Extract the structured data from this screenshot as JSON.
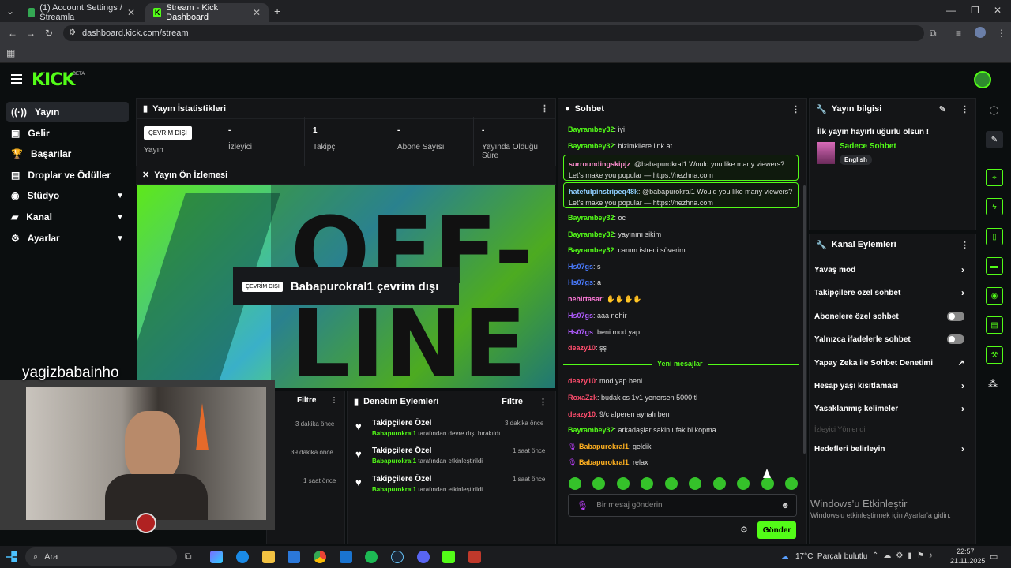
{
  "browser": {
    "tabs": [
      {
        "title": "(1) Account Settings / Streamla"
      },
      {
        "title": "Stream - Kick Dashboard"
      }
    ],
    "url": "dashboard.kick.com/stream"
  },
  "app": {
    "logo": "KICK",
    "beta": "BETA"
  },
  "sidebar": {
    "items": [
      {
        "label": "Yayın",
        "icon": "broadcast-icon"
      },
      {
        "label": "Gelir",
        "icon": "revenue-icon"
      },
      {
        "label": "Başarılar",
        "icon": "trophy-icon"
      },
      {
        "label": "Droplar ve Ödüller",
        "icon": "gift-icon"
      },
      {
        "label": "Stüdyo",
        "icon": "studio-icon"
      },
      {
        "label": "Kanal",
        "icon": "channel-icon"
      },
      {
        "label": "Ayarlar",
        "icon": "gear-icon"
      }
    ]
  },
  "stats": {
    "title": "Yayın İstatistikleri",
    "status_badge": "ÇEVRİM DIŞI",
    "items": [
      {
        "value": "",
        "label": "Yayın"
      },
      {
        "value": "-",
        "label": "İzleyici"
      },
      {
        "value": "1",
        "label": "Takipçi"
      },
      {
        "value": "-",
        "label": "Abone Sayısı"
      },
      {
        "value": "-",
        "label": "Yayında Olduğu Süre"
      }
    ]
  },
  "preview": {
    "title": "Yayın Ön İzlemesi",
    "bg_text_1": "OFF-",
    "bg_text_2": "LINE",
    "badge": "ÇEVRİM DIŞI",
    "message": "Babapurokral1 çevrim dışı"
  },
  "webcam": {
    "name": "yagizbabainho"
  },
  "left_feed": {
    "filter": "Filtre",
    "times": [
      "3 dakika önce",
      "39 dakika önce",
      "1 saat önce"
    ]
  },
  "moderation": {
    "title": "Denetim Eylemleri",
    "filter": "Filtre",
    "items": [
      {
        "title": "Takipçilere Özel",
        "user": "Babapurokral1",
        "action": "tarafından devre dışı bırakıldı",
        "time": "3 dakika önce"
      },
      {
        "title": "Takipçilere Özel",
        "user": "Babapurokral1",
        "action": "tarafından etkinleştirildi",
        "time": "1 saat önce"
      },
      {
        "title": "Takipçilere Özel",
        "user": "Babapurokral1",
        "action": "tarafından etkinleştirildi",
        "time": "1 saat önce"
      }
    ]
  },
  "chat": {
    "title": "Sohbet",
    "messages": [
      {
        "user": "Bayrambey32",
        "text": ": iyi",
        "color": "#53fc18"
      },
      {
        "user": "Bayrambey32",
        "text": ": bizimkilere link at",
        "color": "#53fc18"
      },
      {
        "user": "Bayrambey32",
        "text": ": oc",
        "color": "#53fc18"
      },
      {
        "user": "Bayrambey32",
        "text": ": yayınını sikim",
        "color": "#53fc18"
      },
      {
        "user": "Bayrambey32",
        "text": ": canım istredi söverim",
        "color": "#53fc18"
      },
      {
        "user": "Hs07gs",
        "text": ": s",
        "color": "#4a7bff"
      },
      {
        "user": "Hs07gs",
        "text": ": a",
        "color": "#4a7bff"
      },
      {
        "user": "nehirtasar",
        "text": ": ✋✋✋✋",
        "color": "#ff7ad9"
      },
      {
        "user": "Hs07gs",
        "text": ": aaa nehir",
        "color": "#b05cff"
      },
      {
        "user": "Hs07gs",
        "text": ": beni mod yap",
        "color": "#b05cff"
      },
      {
        "user": "deazy10",
        "text": ": şş",
        "color": "#ff4d6d"
      },
      {
        "user": "deazy10",
        "text": ": mod yap beni",
        "color": "#ff4d6d"
      },
      {
        "user": "RoxaZzk",
        "text": ": budak cs 1v1 yenersen 5000 tl",
        "color": "#ff4d6d"
      },
      {
        "user": "deazy10",
        "text": ": 9/c alperen aynalı ben",
        "color": "#ff4d6d"
      },
      {
        "user": "Bayrambey32",
        "text": ": arkadaşlar sakin ufak bi kopma",
        "color": "#53fc18"
      },
      {
        "user": "Babapurokral1",
        "text": ": geldik",
        "color": "#ffb020"
      },
      {
        "user": "Babapurokral1",
        "text": ": relax",
        "color": "#ffb020"
      }
    ],
    "highlighted": [
      {
        "user": "surroundingskipjz",
        "text": ": @babapurokral1 Would you like many viewers? Let's make you popular — https://nezhna.com",
        "color": "#ff8fd0"
      },
      {
        "user": "hatefulpinstripeq48k",
        "text": ": @babapurokral1 Would you like many viewers? Let's make you popular — https://nezhna.com",
        "color": "#8fd0ff"
      }
    ],
    "new_messages": "Yeni mesajlar",
    "input_placeholder": "Bir mesaj gönderin",
    "send": "Gönder"
  },
  "stream_info": {
    "title": "Yayın bilgisi",
    "stream_title": "İlk yayın hayırlı uğurlu olsun !",
    "category": "Sadece Sohbet",
    "tag": "English"
  },
  "channel_actions": {
    "title": "Kanal Eylemleri",
    "items": [
      {
        "label": "Yavaş mod",
        "type": "arrow"
      },
      {
        "label": "Takipçilere özel sohbet",
        "type": "arrow"
      },
      {
        "label": "Abonelere özel sohbet",
        "type": "toggle"
      },
      {
        "label": "Yalnızca ifadelerle sohbet",
        "type": "toggle"
      },
      {
        "label": "Yapay Zeka ile Sohbet Denetimi",
        "type": "ext"
      },
      {
        "label": "Hesap yaşı kısıtlaması",
        "type": "arrow"
      },
      {
        "label": "Yasaklanmış kelimeler",
        "type": "arrow"
      },
      {
        "label": "İzleyici Yönlendir",
        "type": "disabled"
      },
      {
        "label": "Hedefleri belirleyin",
        "type": "arrow"
      }
    ]
  },
  "watermark": {
    "line1": "Windows'u Etkinleştir",
    "line2": "Windows'u etkinleştirmek için Ayarlar'a gidin."
  },
  "taskbar": {
    "search": "Ara",
    "weather": "17°C  Parçalı bulutlu",
    "time": "22:57",
    "date": "21.11.2025"
  }
}
